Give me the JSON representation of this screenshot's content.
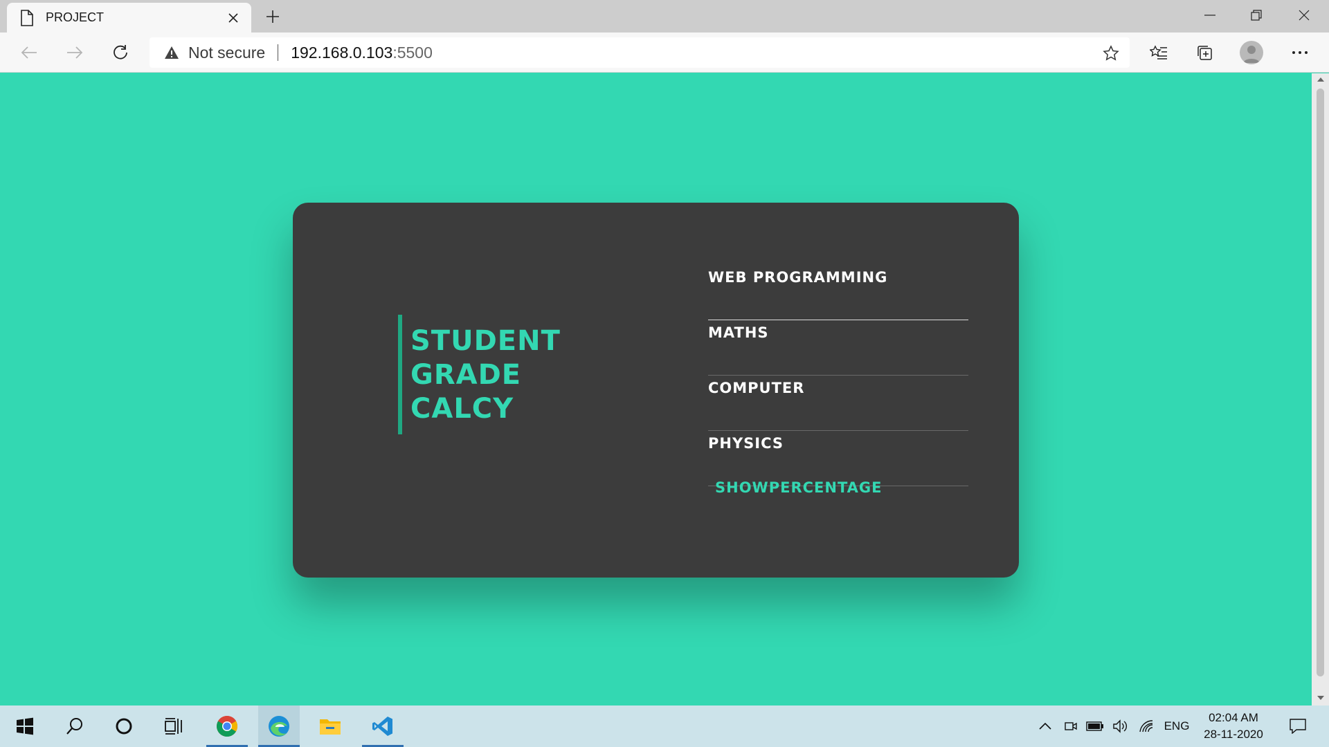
{
  "browser": {
    "tab_title": "PROJECT",
    "address": {
      "security_label": "Not secure",
      "host": "192.168.0.103",
      "port": ":5500"
    }
  },
  "page": {
    "brand_lines": [
      "STUDENT",
      "GRADE",
      "CALCY"
    ],
    "subjects": [
      {
        "label": "WEB PROGRAMMING"
      },
      {
        "label": "MATHS"
      },
      {
        "label": "COMPUTER"
      },
      {
        "label": "PHYSICS"
      }
    ],
    "show_button": "SHOWPERCENTAGE",
    "colors": {
      "background": "#33d8b2",
      "card": "#3c3c3c",
      "accent": "#33d8b2"
    }
  },
  "taskbar": {
    "apps": [
      "start-icon",
      "search-icon",
      "cortana-icon",
      "task-view-icon",
      "chrome-icon",
      "edge-icon",
      "file-explorer-icon",
      "vscode-icon"
    ],
    "tray": {
      "language": "ENG",
      "time": "02:04 AM",
      "date": "28-11-2020"
    }
  }
}
